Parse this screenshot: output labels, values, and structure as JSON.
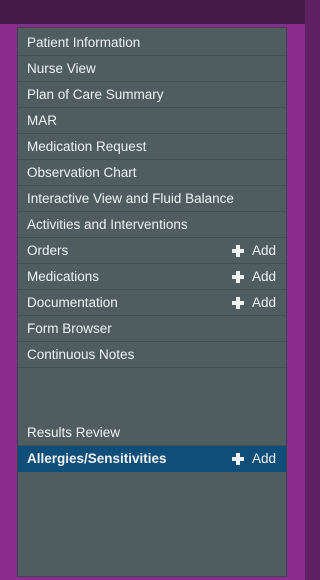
{
  "menu": {
    "items": [
      {
        "label": "Patient Information"
      },
      {
        "label": "Nurse View"
      },
      {
        "label": "Plan of Care Summary"
      },
      {
        "label": "MAR"
      },
      {
        "label": "Medication Request"
      },
      {
        "label": "Observation Chart"
      },
      {
        "label": "Interactive View and Fluid Balance"
      },
      {
        "label": "Activities and Interventions"
      },
      {
        "label": "Orders",
        "action": "Add"
      },
      {
        "label": "Medications",
        "action": "Add"
      },
      {
        "label": "Documentation",
        "action": "Add"
      },
      {
        "label": "Form Browser"
      },
      {
        "label": "Continuous Notes"
      },
      {
        "label": "Results Review"
      },
      {
        "label": "Allergies/Sensitivities",
        "action": "Add",
        "selected": true
      }
    ]
  },
  "colors": {
    "background": "#5e2060",
    "frame": "#8b2a8f",
    "panel": "#4f5d60",
    "selected": "#0e4e79",
    "text": "#eef2f3"
  }
}
